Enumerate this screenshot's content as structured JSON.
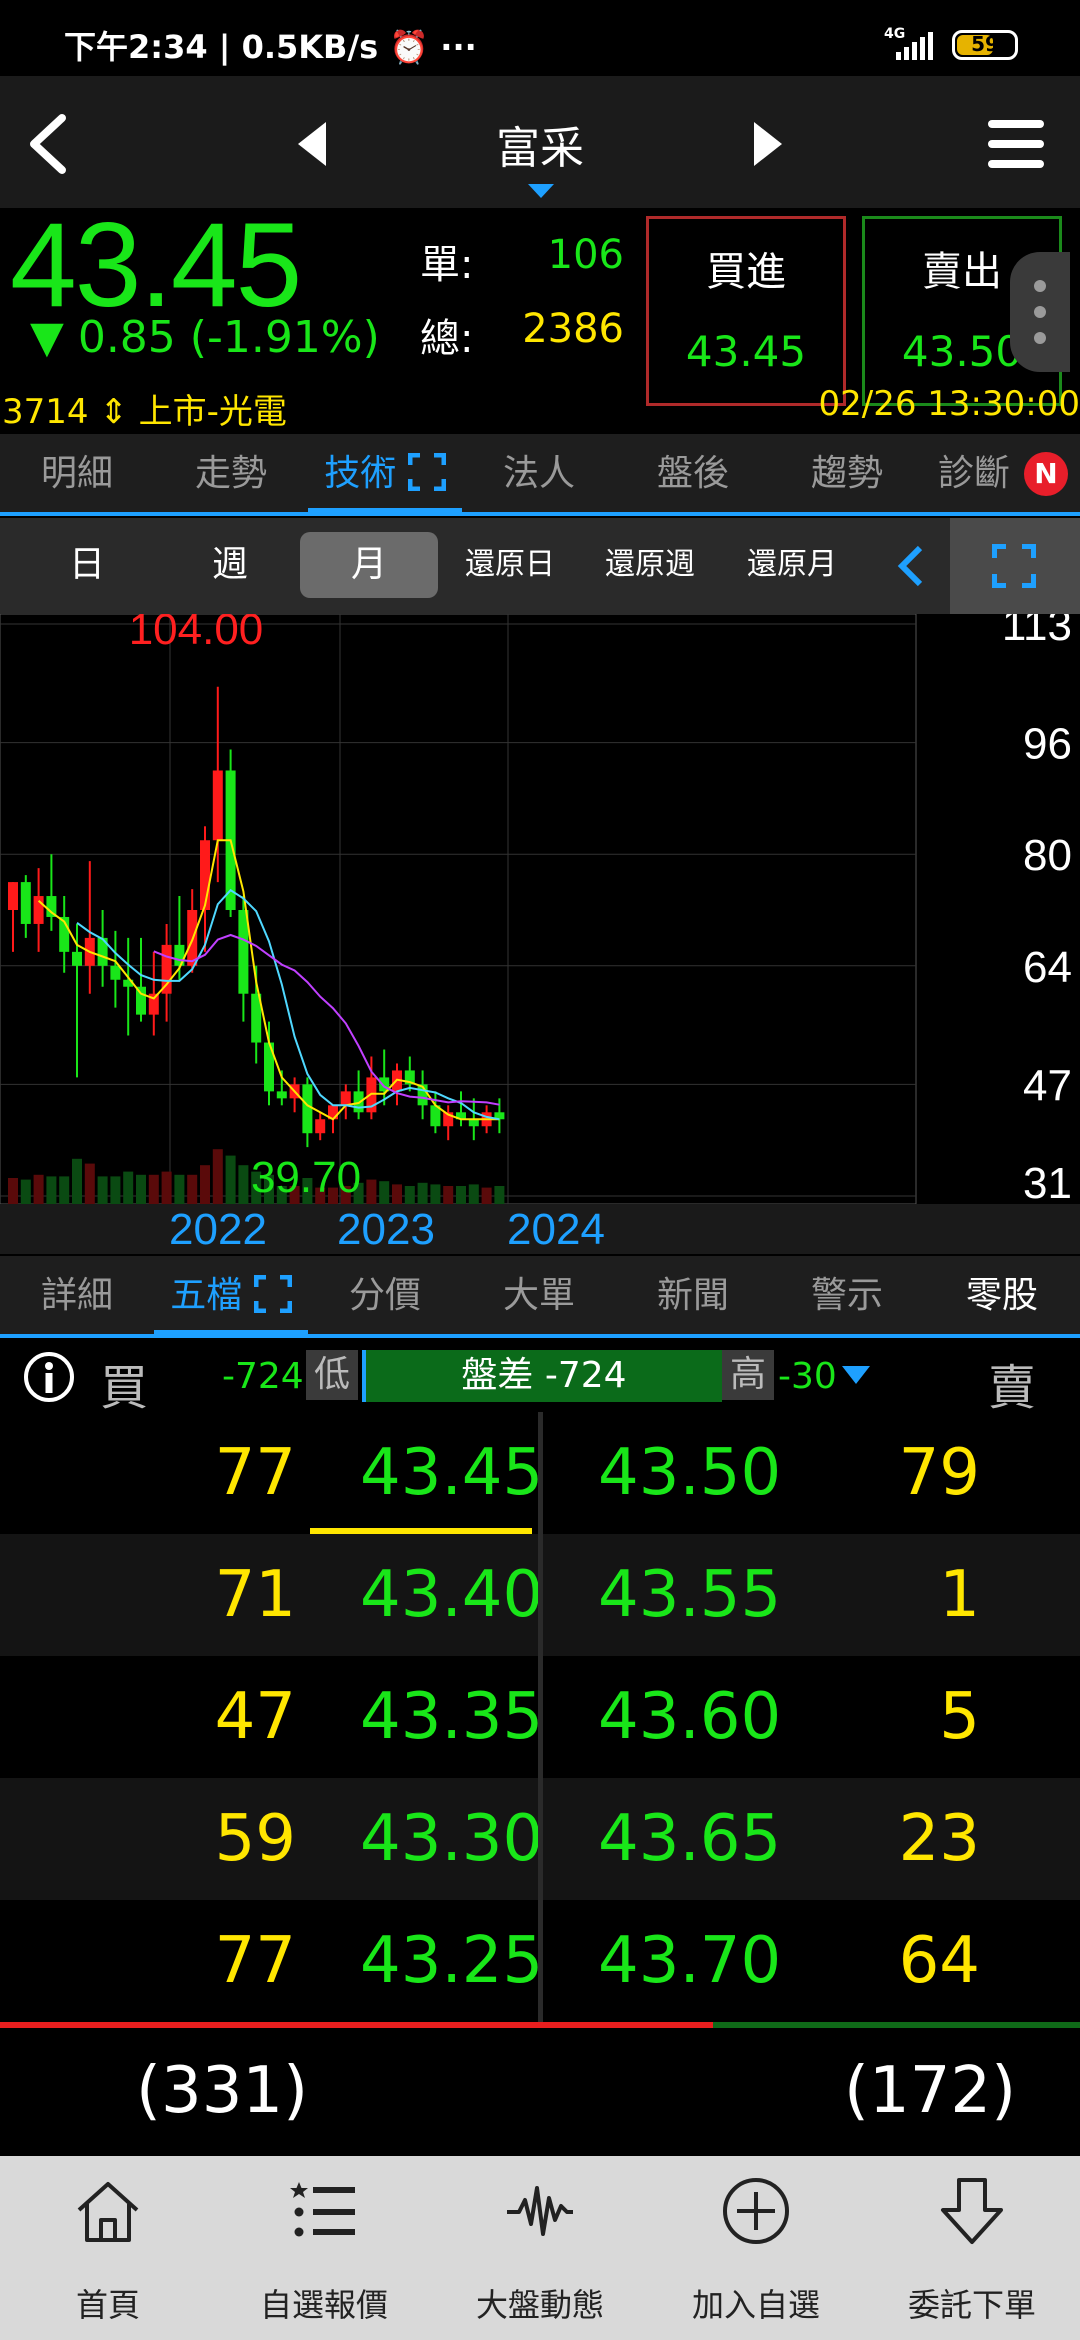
{
  "status_bar": {
    "time": "下午2:34 | 0.5KB/s ⏰ ···",
    "network": "4G",
    "battery": "59"
  },
  "header": {
    "title": "富采"
  },
  "quote": {
    "price": "43.45",
    "change": "▼ 0.85",
    "change_pct": "(-1.91%)",
    "single_label": "單:",
    "single_value": "106",
    "total_label": "總:",
    "total_value": "2386",
    "buy_label": "買進",
    "buy_price": "43.45",
    "sell_label": "賣出",
    "sell_price": "43.50",
    "stock_code": "3714",
    "market": "上市-光電",
    "datetime": "02/26 13:30:00"
  },
  "tabs1": [
    {
      "label": "明細"
    },
    {
      "label": "走勢"
    },
    {
      "label": "技術"
    },
    {
      "label": "法人"
    },
    {
      "label": "盤後"
    },
    {
      "label": "趨勢"
    },
    {
      "label": "診斷"
    }
  ],
  "tabs1_badge": "N",
  "period": [
    {
      "label": "日"
    },
    {
      "label": "週"
    },
    {
      "label": "月"
    },
    {
      "label": "還原日"
    },
    {
      "label": "還原週"
    },
    {
      "label": "還原月"
    }
  ],
  "chart_data": {
    "type": "candlestick",
    "high_label": "104.00",
    "low_label": "39.70",
    "y_ticks": [
      "113",
      "96",
      "80",
      "64",
      "47",
      "31"
    ],
    "x_labels": [
      "2022",
      "2023",
      "2024"
    ],
    "ylim": [
      31,
      113
    ],
    "colors": {
      "up": "#ff1a1a",
      "down": "#19e619",
      "ma1": "#ffe600",
      "ma2": "#4fd8ff",
      "ma3": "#c040ff"
    },
    "candles": [
      {
        "o": 72,
        "h": 76,
        "l": 66,
        "c": 76
      },
      {
        "o": 76,
        "h": 77,
        "l": 68,
        "c": 70
      },
      {
        "o": 70,
        "h": 78,
        "l": 66,
        "c": 74
      },
      {
        "o": 74,
        "h": 80,
        "l": 69,
        "c": 71
      },
      {
        "o": 71,
        "h": 74,
        "l": 63,
        "c": 66
      },
      {
        "o": 66,
        "h": 70,
        "l": 48,
        "c": 64
      },
      {
        "o": 64,
        "h": 79,
        "l": 60,
        "c": 68
      },
      {
        "o": 68,
        "h": 72,
        "l": 61,
        "c": 64
      },
      {
        "o": 64,
        "h": 69,
        "l": 58,
        "c": 62
      },
      {
        "o": 62,
        "h": 68,
        "l": 54,
        "c": 61
      },
      {
        "o": 61,
        "h": 68,
        "l": 56,
        "c": 57
      },
      {
        "o": 57,
        "h": 66,
        "l": 54,
        "c": 60
      },
      {
        "o": 60,
        "h": 70,
        "l": 56,
        "c": 67
      },
      {
        "o": 67,
        "h": 74,
        "l": 62,
        "c": 64
      },
      {
        "o": 64,
        "h": 75,
        "l": 63,
        "c": 72
      },
      {
        "o": 72,
        "h": 84,
        "l": 66,
        "c": 82
      },
      {
        "o": 82,
        "h": 104,
        "l": 76,
        "c": 92
      },
      {
        "o": 92,
        "h": 95,
        "l": 71,
        "c": 72
      },
      {
        "o": 72,
        "h": 74,
        "l": 56,
        "c": 60
      },
      {
        "o": 60,
        "h": 64,
        "l": 50,
        "c": 53
      },
      {
        "o": 53,
        "h": 56,
        "l": 44,
        "c": 46
      },
      {
        "o": 46,
        "h": 49,
        "l": 44,
        "c": 45
      },
      {
        "o": 45,
        "h": 48,
        "l": 43,
        "c": 47
      },
      {
        "o": 47,
        "h": 48,
        "l": 38,
        "c": 40
      },
      {
        "o": 40,
        "h": 43,
        "l": 39,
        "c": 42
      },
      {
        "o": 42,
        "h": 44,
        "l": 40,
        "c": 44
      },
      {
        "o": 44,
        "h": 47,
        "l": 42,
        "c": 46
      },
      {
        "o": 46,
        "h": 49,
        "l": 42,
        "c": 43
      },
      {
        "o": 43,
        "h": 51,
        "l": 42,
        "c": 48
      },
      {
        "o": 48,
        "h": 52,
        "l": 44,
        "c": 46
      },
      {
        "o": 46,
        "h": 50,
        "l": 44,
        "c": 49
      },
      {
        "o": 49,
        "h": 51,
        "l": 46,
        "c": 47
      },
      {
        "o": 47,
        "h": 49,
        "l": 42,
        "c": 44
      },
      {
        "o": 44,
        "h": 46,
        "l": 40,
        "c": 41
      },
      {
        "o": 41,
        "h": 44,
        "l": 39,
        "c": 43
      },
      {
        "o": 43,
        "h": 46,
        "l": 41,
        "c": 42
      },
      {
        "o": 42,
        "h": 45,
        "l": 39,
        "c": 41
      },
      {
        "o": 41,
        "h": 44,
        "l": 40,
        "c": 43
      },
      {
        "o": 43,
        "h": 45,
        "l": 40,
        "c": 42
      }
    ]
  },
  "tabs2": [
    {
      "label": "詳細"
    },
    {
      "label": "五檔"
    },
    {
      "label": "分價"
    },
    {
      "label": "大單"
    },
    {
      "label": "新聞"
    },
    {
      "label": "警示"
    },
    {
      "label": "零股"
    }
  ],
  "orderbook": {
    "buy_label": "買",
    "sell_label": "賣",
    "diff_left": "-724",
    "low_label": "低",
    "diff_center": "盤差 -724",
    "high_label": "高",
    "high_value": "-30",
    "rows": [
      {
        "bid_qty": "77",
        "bid": "43.45",
        "ask": "43.50",
        "ask_qty": "79"
      },
      {
        "bid_qty": "71",
        "bid": "43.40",
        "ask": "43.55",
        "ask_qty": "1"
      },
      {
        "bid_qty": "47",
        "bid": "43.35",
        "ask": "43.60",
        "ask_qty": "5"
      },
      {
        "bid_qty": "59",
        "bid": "43.30",
        "ask": "43.65",
        "ask_qty": "23"
      },
      {
        "bid_qty": "77",
        "bid": "43.25",
        "ask": "43.70",
        "ask_qty": "64"
      }
    ],
    "bid_total": "(331)",
    "ask_total": "(172)",
    "bid_ratio": 0.66
  },
  "nav": [
    {
      "label": "首頁",
      "icon": "home-icon"
    },
    {
      "label": "自選報價",
      "icon": "list-icon"
    },
    {
      "label": "大盤動態",
      "icon": "pulse-icon"
    },
    {
      "label": "加入自選",
      "icon": "plus-circle-icon"
    },
    {
      "label": "委託下單",
      "icon": "down-arrow-icon"
    }
  ]
}
